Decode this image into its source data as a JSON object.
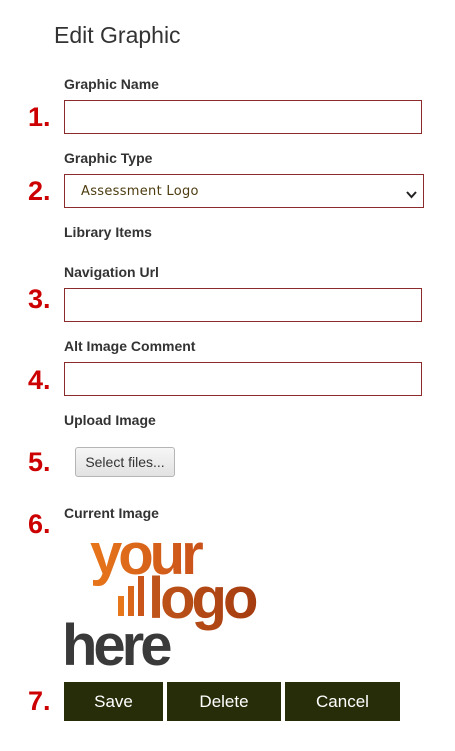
{
  "form": {
    "title": "Edit Graphic",
    "fields": {
      "graphic_name": {
        "label": "Graphic Name",
        "value": ""
      },
      "graphic_type": {
        "label": "Graphic Type",
        "selected": "Assessment Logo"
      },
      "library_items": {
        "label": "Library Items"
      },
      "navigation_url": {
        "label": "Navigation Url",
        "value": ""
      },
      "alt_image_comment": {
        "label": "Alt Image Comment",
        "value": ""
      },
      "upload_image": {
        "label": "Upload Image",
        "button": "Select files..."
      },
      "current_image": {
        "label": "Current Image",
        "logo_text": {
          "line1": "your",
          "line2": "logo",
          "line3": "here"
        }
      }
    },
    "actions": {
      "save": "Save",
      "delete": "Delete",
      "cancel": "Cancel"
    }
  },
  "step_numbers": [
    "1.",
    "2.",
    "3.",
    "4.",
    "5.",
    "6.",
    "7."
  ],
  "colors": {
    "step_number": "#cc0000",
    "input_border": "#8b2b2b",
    "button_bg": "#262d08",
    "logo_orange": "#e8761a",
    "logo_dark_orange": "#b5470f",
    "logo_gray": "#3a3a3a"
  },
  "icons": {
    "select_arrow": "chevron-down-icon"
  }
}
